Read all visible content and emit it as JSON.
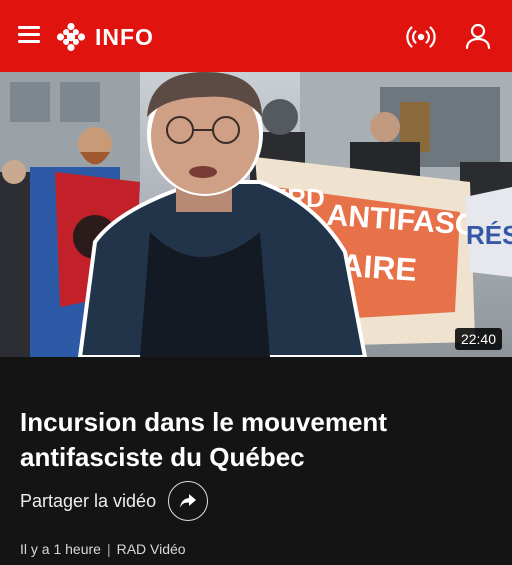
{
  "header": {
    "brand": "INFO",
    "icons": {
      "menu": "menu-icon",
      "logo": "cbc-gem-logo-icon",
      "live": "live-broadcast-icon",
      "account": "user-icon"
    },
    "background": "#e1130e"
  },
  "video": {
    "duration": "22:40",
    "banner_left": "IRD",
    "banner_main": "ANTIFASCISTE",
    "banner_sub": "AIRE",
    "banner_right": "RÉSI"
  },
  "article": {
    "title": "Incursion dans le mouvement antifasciste du Québec",
    "share_label": "Partager la vidéo",
    "share_icon": "share-arrow-icon",
    "age": "Il y a 1 heure",
    "source": "RAD Vidéo"
  }
}
